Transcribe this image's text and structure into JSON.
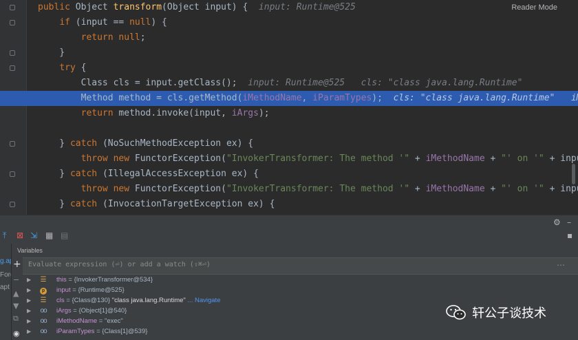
{
  "editor": {
    "reader_mode": "Reader Mode",
    "lines": [
      [
        [
          "kw",
          "public "
        ],
        [
          "t",
          "Object "
        ],
        [
          "fn",
          "transform"
        ],
        [
          "t",
          "(Object input) {"
        ],
        [
          "hint",
          "  input: Runtime@525"
        ]
      ],
      [
        [
          "t",
          "    "
        ],
        [
          "kw",
          "if "
        ],
        [
          "t",
          "(input == "
        ],
        [
          "kw",
          "null"
        ],
        [
          "t",
          ") {"
        ]
      ],
      [
        [
          "t",
          "        "
        ],
        [
          "kw",
          "return null"
        ],
        [
          "t",
          ";"
        ]
      ],
      [
        [
          "t",
          "    }"
        ]
      ],
      [
        [
          "t",
          "    "
        ],
        [
          "kw",
          "try "
        ],
        [
          "t",
          "{"
        ]
      ],
      [
        [
          "t",
          "        Class cls = input.getClass();"
        ],
        [
          "hint",
          "  input: Runtime@525   cls: \"class java.lang.Runtime\""
        ]
      ],
      [
        [
          "t",
          "        Method method = cls.getMethod("
        ],
        [
          "fld",
          "iMethodName"
        ],
        [
          "t",
          ", "
        ],
        [
          "fld",
          "iParamTypes"
        ],
        [
          "t",
          ");"
        ],
        [
          "hint",
          "  cls: \"class java.lang.Runtime\"   iM"
        ]
      ],
      [
        [
          "t",
          "        "
        ],
        [
          "kw",
          "return "
        ],
        [
          "t",
          "method.invoke(input, "
        ],
        [
          "fld",
          "iArgs"
        ],
        [
          "t",
          ");"
        ]
      ],
      [
        [
          "t",
          ""
        ]
      ],
      [
        [
          "t",
          "    } "
        ],
        [
          "kw",
          "catch "
        ],
        [
          "t",
          "(NoSuchMethodException ex) {"
        ]
      ],
      [
        [
          "t",
          "        "
        ],
        [
          "kw",
          "throw new "
        ],
        [
          "t",
          "FunctorException("
        ],
        [
          "str",
          "\"InvokerTransformer: The method '\""
        ],
        [
          "t",
          " + "
        ],
        [
          "fld",
          "iMethodName"
        ],
        [
          "t",
          " + "
        ],
        [
          "str",
          "\"' on '\""
        ],
        [
          "t",
          " + input"
        ]
      ],
      [
        [
          "t",
          "    } "
        ],
        [
          "kw",
          "catch "
        ],
        [
          "t",
          "(IllegalAccessException ex) {"
        ]
      ],
      [
        [
          "t",
          "        "
        ],
        [
          "kw",
          "throw new "
        ],
        [
          "t",
          "FunctorException("
        ],
        [
          "str",
          "\"InvokerTransformer: The method '\""
        ],
        [
          "t",
          " + "
        ],
        [
          "fld",
          "iMethodName"
        ],
        [
          "t",
          " + "
        ],
        [
          "str",
          "\"' on '\""
        ],
        [
          "t",
          " + input"
        ]
      ],
      [
        [
          "t",
          "    } "
        ],
        [
          "kw",
          "catch "
        ],
        [
          "t",
          "(InvocationTargetException ex) {"
        ]
      ],
      [
        [
          "t",
          "        "
        ],
        [
          "kw",
          "throw new "
        ],
        [
          "t",
          "FunctorException("
        ],
        [
          "str",
          "\"InvokerTransformer: The method '\""
        ],
        [
          "t",
          " + "
        ],
        [
          "fld",
          "iMethodName"
        ],
        [
          "t",
          " + "
        ],
        [
          "str",
          "\"' on '\""
        ],
        [
          "t",
          " + input"
        ]
      ]
    ]
  },
  "debugger": {
    "variables_label": "Variables",
    "eval_placeholder": "Evaluate expression (⏎) or add a watch (⇧⌘⏎)",
    "frame_fragments": [
      "g.ap",
      "Forg",
      "apt"
    ],
    "vars": [
      {
        "icon": "field",
        "name": "this",
        "value": "{InvokerTransformer@534}",
        "extra": "",
        "link": ""
      },
      {
        "icon": "param",
        "name": "input",
        "value": "{Runtime@525}",
        "extra": "",
        "link": ""
      },
      {
        "icon": "field",
        "name": "cls",
        "value": "{Class@130}",
        "extra": "\"class java.lang.Runtime\"",
        "link": "... Navigate"
      },
      {
        "icon": "watch",
        "name": "iArgs",
        "value": "{Object[1]@540}",
        "extra": "",
        "link": ""
      },
      {
        "icon": "watch",
        "name": "iMethodName",
        "value": "\"exec\"",
        "extra": "",
        "link": ""
      },
      {
        "icon": "watch",
        "name": "iParamTypes",
        "value": "{Class[1]@539}",
        "extra": "",
        "link": ""
      }
    ]
  },
  "watermark": {
    "text": "轩公子谈技术"
  },
  "colors": {
    "highlight": "#2d5bb0",
    "keyword": "#cc7832",
    "method": "#ffc66d",
    "field": "#9876aa",
    "string": "#6a8759"
  }
}
